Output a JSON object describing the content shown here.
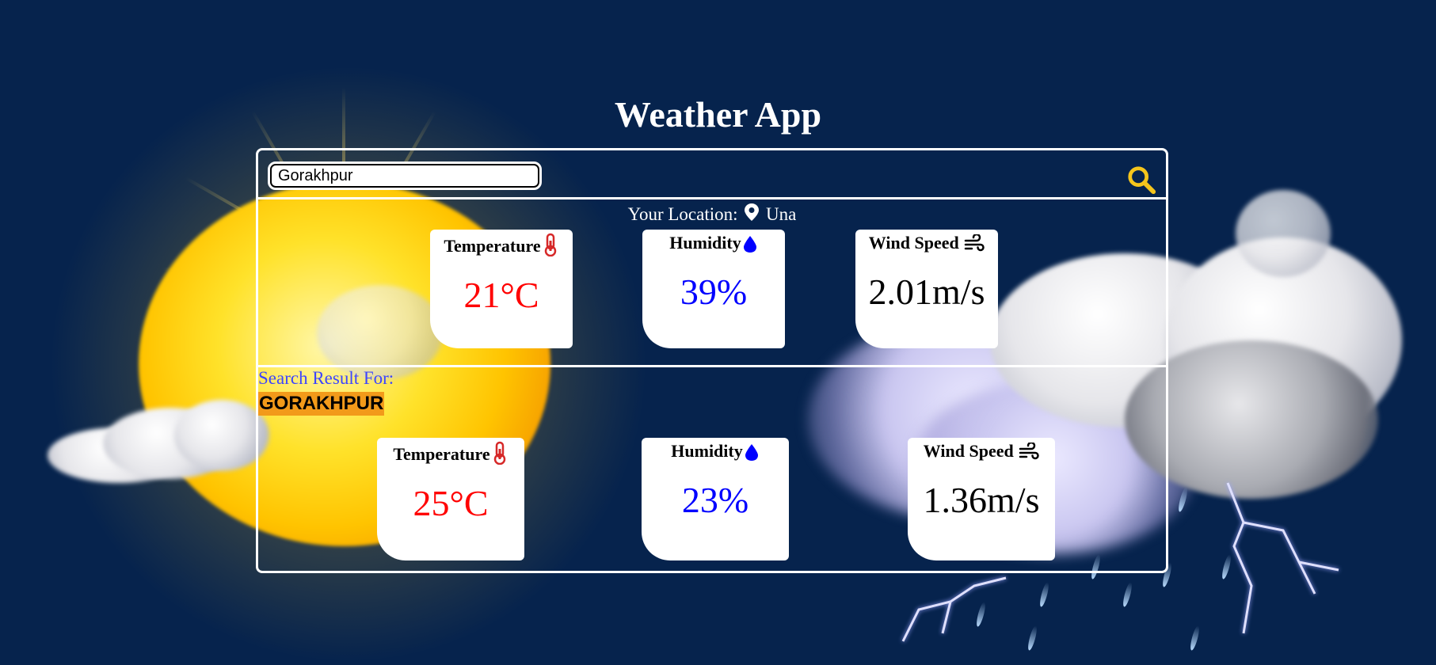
{
  "app": {
    "title": "Weather App"
  },
  "search": {
    "value": "Gorakhpur",
    "icon": "search-icon",
    "icon_color": "#f5c51c"
  },
  "location": {
    "label": "Your Location:",
    "icon": "location-pin-icon",
    "city": "Una"
  },
  "current": {
    "temperature": {
      "label": "Temperature",
      "value": "21°C",
      "color": "#ff0000"
    },
    "humidity": {
      "label": "Humidity",
      "value": "39%",
      "color": "#0000ff"
    },
    "wind": {
      "label": "Wind Speed",
      "value": "2.01m/s",
      "color": "#000000"
    }
  },
  "result": {
    "label": "Search Result For:",
    "city": "GORAKHPUR",
    "highlight_color": "#f29a1a",
    "temperature": {
      "label": "Temperature",
      "value": "25°C"
    },
    "humidity": {
      "label": "Humidity",
      "value": "23%"
    },
    "wind": {
      "label": "Wind Speed",
      "value": "1.36m/s"
    }
  }
}
